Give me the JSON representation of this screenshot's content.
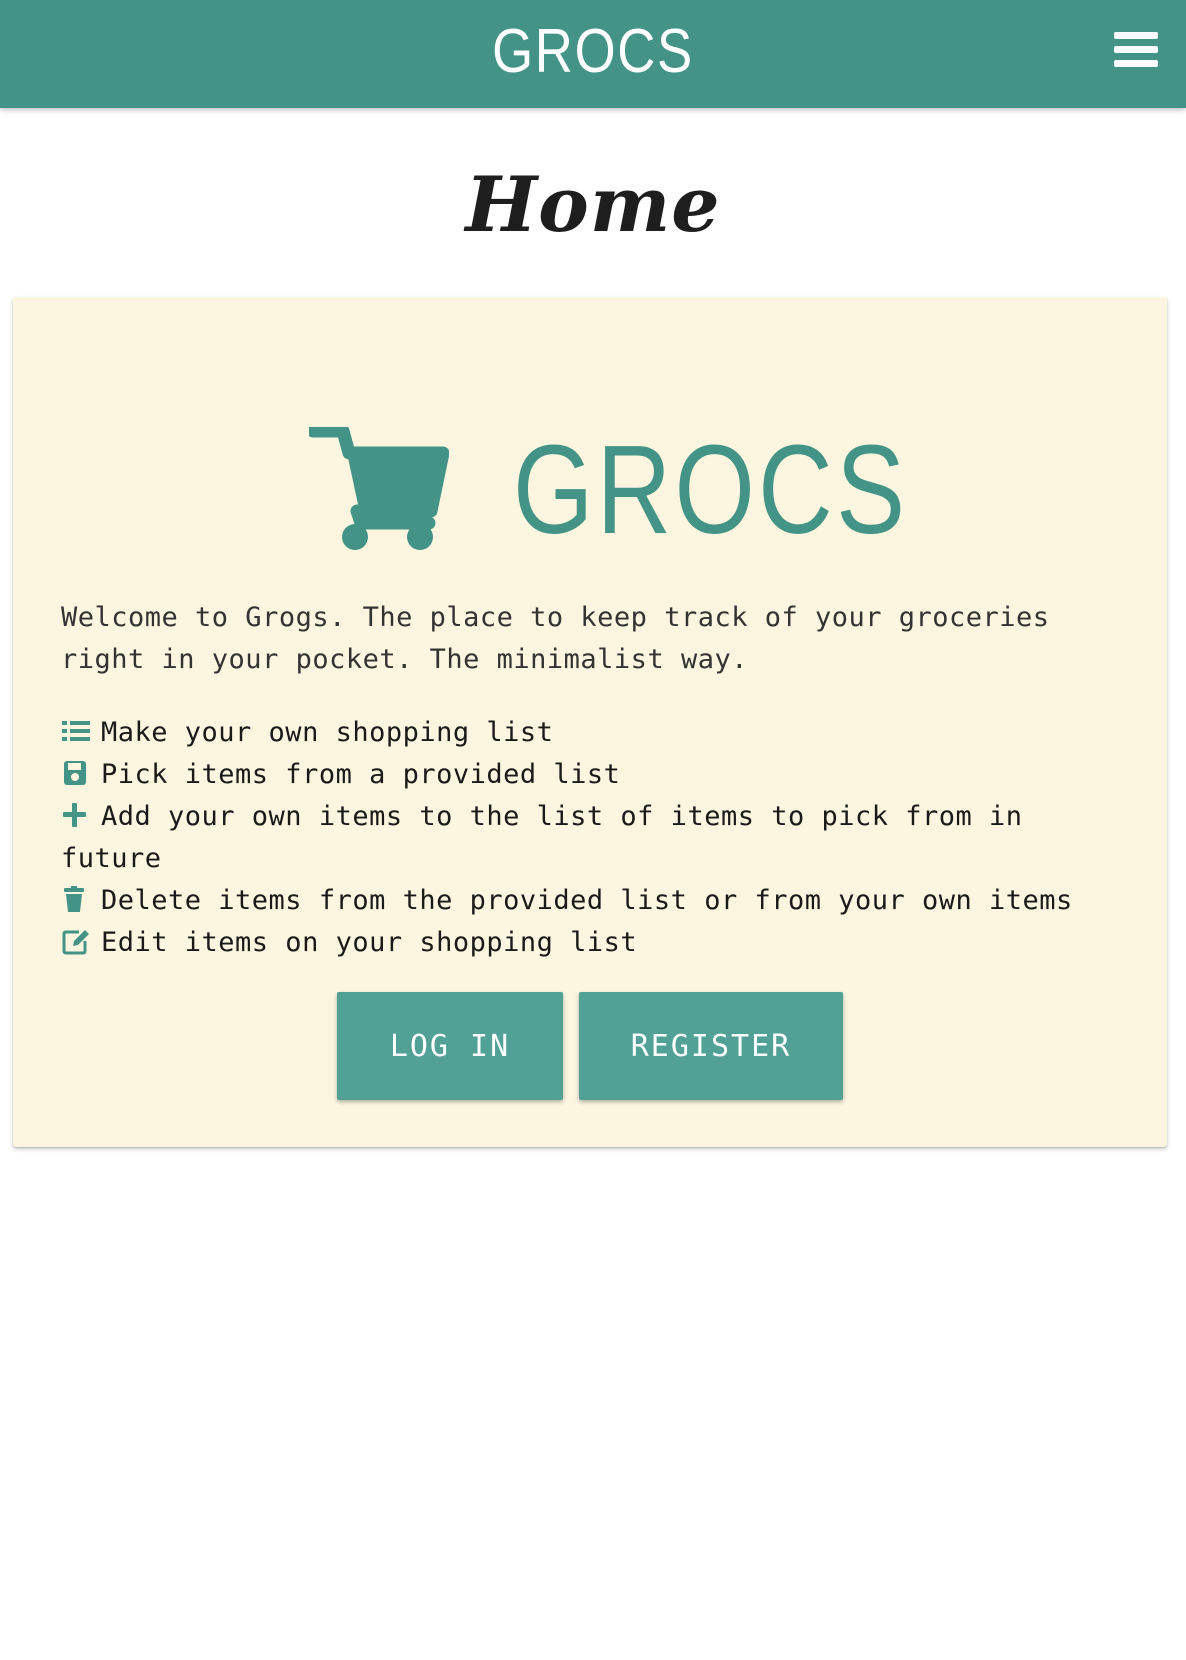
{
  "navbar": {
    "brand": "GROCS",
    "menu_icon": "hamburger-menu-icon"
  },
  "page": {
    "title": "Home"
  },
  "hero": {
    "icon": "shopping-cart-icon",
    "title": "GROCS"
  },
  "intro_text": "Welcome to Grogs. The place to keep track of your groceries right in your pocket. The minimalist way.",
  "features": [
    {
      "icon": "list-icon",
      "text": "Make your own shopping list"
    },
    {
      "icon": "save-icon",
      "text": "Pick items from a provided list"
    },
    {
      "icon": "plus-icon",
      "text": "Add your own items to the list of items to pick from in future"
    },
    {
      "icon": "trash-icon",
      "text": "Delete items from the provided list or from your own items"
    },
    {
      "icon": "edit-icon",
      "text": "Edit items on your shopping list"
    }
  ],
  "buttons": {
    "login": "LOG IN",
    "register": "REGISTER"
  },
  "colors": {
    "accent": "#439486",
    "button": "#52a196",
    "card_background": "#fcf6e0"
  }
}
